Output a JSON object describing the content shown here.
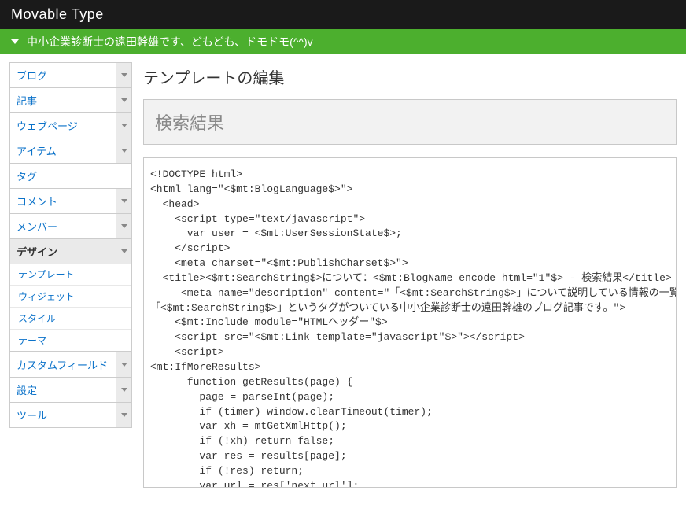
{
  "header": {
    "app_name": "Movable Type",
    "site_name": "中小企業診断士の遠田幹雄です、どもども、ドモドモ(^^)v"
  },
  "sidebar": {
    "items": [
      {
        "label": "ブログ",
        "has_toggle": true
      },
      {
        "label": "記事",
        "has_toggle": true
      },
      {
        "label": "ウェブページ",
        "has_toggle": true
      },
      {
        "label": "アイテム",
        "has_toggle": true
      },
      {
        "label": "タグ",
        "has_toggle": false
      },
      {
        "label": "コメント",
        "has_toggle": true
      },
      {
        "label": "メンバー",
        "has_toggle": true
      },
      {
        "label": "デザイン",
        "has_toggle": true,
        "active": true,
        "expanded": true,
        "children": [
          {
            "label": "テンプレート"
          },
          {
            "label": "ウィジェット"
          },
          {
            "label": "スタイル"
          },
          {
            "label": "テーマ"
          }
        ]
      },
      {
        "label": "カスタムフィールド",
        "has_toggle": true
      },
      {
        "label": "設定",
        "has_toggle": true
      },
      {
        "label": "ツール",
        "has_toggle": true
      }
    ]
  },
  "main": {
    "page_title": "テンプレートの編集",
    "template_name": "検索結果",
    "code": "<!DOCTYPE html>\n<html lang=\"<$mt:BlogLanguage$>\">\n  <head>\n    <script type=\"text/javascript\">\n      var user = <$mt:UserSessionState$>;\n    </script>\n    <meta charset=\"<$mt:PublishCharset$>\">\n  <title><$mt:SearchString$>について：<$mt:BlogName encode_html=\"1\"$> - 検索結果</title>\n     <meta name=\"description\" content=\"「<$mt:SearchString$>」について説明している情報の一覧です。\n「<$mt:SearchString$>」というタグがついている中小企業診断士の遠田幹雄のブログ記事です。\">\n    <$mt:Include module=\"HTMLヘッダー\"$>\n    <script src=\"<$mt:Link template=\"javascript\"$>\"></script>\n    <script>\n<mt:IfMoreResults>\n      function getResults(page) {\n        page = parseInt(page);\n        if (timer) window.clearTimeout(timer);\n        var xh = mtGetXmlHttp();\n        if (!xh) return false;\n        var res = results[page];\n        if (!res) return;\n        var url = res['next_url'];\n        if (!url) return;"
  }
}
